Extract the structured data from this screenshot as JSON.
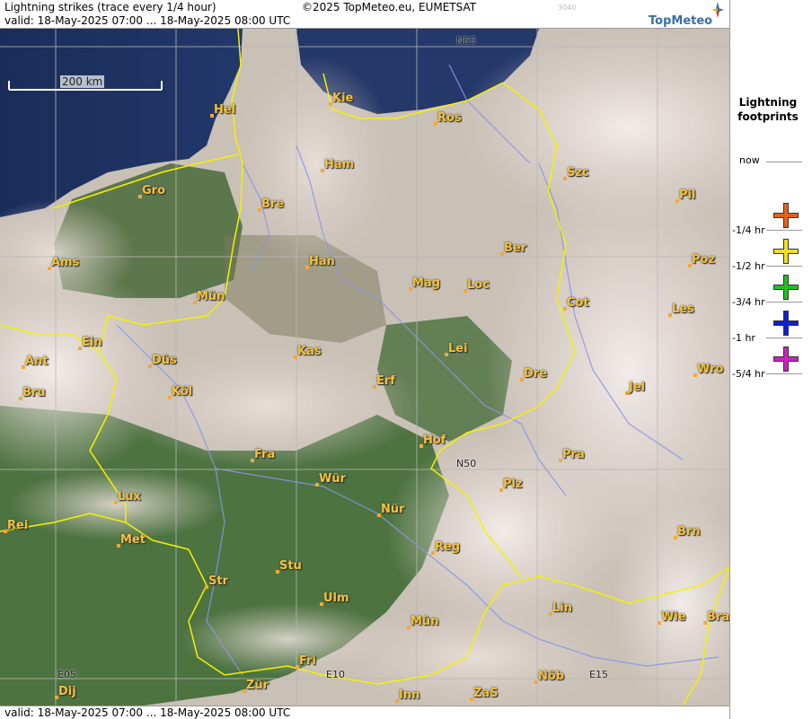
{
  "header": {
    "title": "Lightning strikes (trace every 1/4 hour)",
    "valid": "valid:  18-May-2025 07:00 ... 18-May-2025 08:00 UTC",
    "copyright": "©2025 TopMeteo.eu, EUMETSAT",
    "code": "3040",
    "logo": "TopMeteo",
    "logo_icon": "compass-star-icon"
  },
  "footer": {
    "valid": "valid:  18-May-2025 07:00 ... 18-May-2025 08:00 UTC"
  },
  "map": {
    "scale_label": "200 km",
    "grid_labels": [
      "N55",
      "N50",
      "E05",
      "E10",
      "E15"
    ],
    "cities": [
      "Hel",
      "Kie",
      "Ros",
      "Ham",
      "Szc",
      "Gro",
      "Bre",
      "Pil",
      "Ber",
      "Ams",
      "Han",
      "Poz",
      "Mag",
      "Loc",
      "Mün",
      "Cot",
      "Les",
      "Ein",
      "Kas",
      "Lei",
      "Ant",
      "Düs",
      "Wro",
      "Dre",
      "Bru",
      "Köl",
      "Erf",
      "Jel",
      "Hof",
      "Fra",
      "Pra",
      "N50",
      "Wür",
      "Plz",
      "Lux",
      "Nür",
      "Rei",
      "Met",
      "Reg",
      "Brn",
      "Stu",
      "Str",
      "Ulm",
      "Lin",
      "Mün",
      "Wie",
      "Bra",
      "Fri",
      "Nöb",
      "Zür",
      "Inn",
      "Dij",
      "ZaS"
    ]
  },
  "legend": {
    "title": "Lightning footprints",
    "items": [
      {
        "label": "now",
        "color": ""
      },
      {
        "label": "-1/4 hr",
        "color": "#e8601a"
      },
      {
        "label": "-1/2 hr",
        "color": "#f0e020"
      },
      {
        "label": "-3/4 hr",
        "color": "#20c020"
      },
      {
        "label": "-1 hr",
        "color": "#1020d0"
      },
      {
        "label": "-5/4 hr",
        "color": "#d020c0"
      }
    ]
  },
  "colors": {
    "border": "#f2f200",
    "river": "#8a96e6",
    "city_text": "#f2c23c"
  }
}
